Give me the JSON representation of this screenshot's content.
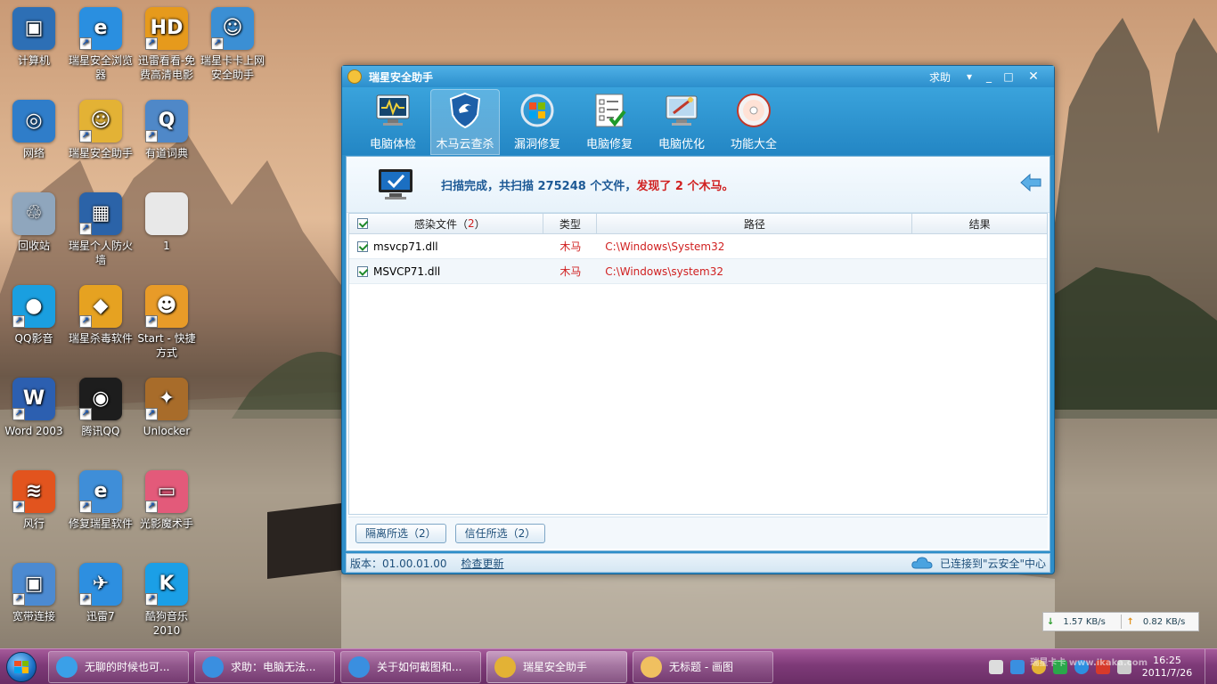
{
  "desktop": {
    "icons": [
      {
        "label": "计算机",
        "color": "#2d6fb5",
        "glyph": "▣"
      },
      {
        "label": "瑞星安全浏览器",
        "color": "#2a8fe0",
        "glyph": "e"
      },
      {
        "label": "迅雷看看-免费高清电影",
        "color": "#e69a1c",
        "glyph": "HD"
      },
      {
        "label": "瑞星卡卡上网安全助手",
        "color": "#3b8fd4",
        "glyph": "☺"
      },
      {
        "label": "网络",
        "color": "#2f7dc9",
        "glyph": "◎"
      },
      {
        "label": "瑞星安全助手",
        "color": "#e3b235",
        "glyph": "☺"
      },
      {
        "label": "有道词典",
        "color": "#4f88c8",
        "glyph": "Q"
      },
      {
        "label": "回收站",
        "color": "#8fa6bd",
        "glyph": "♲"
      },
      {
        "label": "瑞星个人防火墙",
        "color": "#2b63a8",
        "glyph": "▦"
      },
      {
        "label": "1",
        "color": "#e8e8e8",
        "glyph": ""
      },
      {
        "label": "QQ影音",
        "color": "#1a9fe0",
        "glyph": "●"
      },
      {
        "label": "瑞星杀毒软件",
        "color": "#e6a221",
        "glyph": "◆"
      },
      {
        "label": "Start - 快捷方式",
        "color": "#e89b28",
        "glyph": "☻"
      },
      {
        "label": "Word 2003",
        "color": "#2c5fb0",
        "glyph": "W"
      },
      {
        "label": "腾讯QQ",
        "color": "#1d1d1d",
        "glyph": "◉"
      },
      {
        "label": "Unlocker",
        "color": "#a86c2a",
        "glyph": "✦"
      },
      {
        "label": "风行",
        "color": "#e2541e",
        "glyph": "≋"
      },
      {
        "label": "修复瑞星软件",
        "color": "#3f8ed8",
        "glyph": "e"
      },
      {
        "label": "光影魔术手",
        "color": "#e35a7a",
        "glyph": "▭"
      },
      {
        "label": "宽带连接",
        "color": "#4c8ad1",
        "glyph": "▣"
      },
      {
        "label": "迅雷7",
        "color": "#2d8fe0",
        "glyph": "✈"
      },
      {
        "label": "酷狗音乐 2010",
        "color": "#1b9fe6",
        "glyph": "K"
      }
    ]
  },
  "window": {
    "title": "瑞星安全助手",
    "help": "求助",
    "min": "_",
    "max": "□",
    "close": "✕",
    "restore": "▾",
    "tools": [
      {
        "label": "电脑体检",
        "icon": "monitor-check-icon",
        "active": false
      },
      {
        "label": "木马云查杀",
        "icon": "shield-icon",
        "active": true
      },
      {
        "label": "漏洞修复",
        "icon": "windows-update-icon",
        "active": false
      },
      {
        "label": "电脑修复",
        "icon": "checklist-icon",
        "active": false
      },
      {
        "label": "电脑优化",
        "icon": "optimize-icon",
        "active": false
      },
      {
        "label": "功能大全",
        "icon": "disc-icon",
        "active": false
      }
    ],
    "scan": {
      "prefix": "扫描完成，共扫描 ",
      "files": "275248",
      "mid": " 个文件，",
      "found_prefix": "发现了 ",
      "found": "2",
      "found_suffix": " 个木马。"
    },
    "table": {
      "col_file": "感染文件（",
      "col_file_count": "2",
      "col_file_close": "）",
      "col_type": "类型",
      "col_path": "路径",
      "col_result": "结果",
      "rows": [
        {
          "file": "msvcp71.dll",
          "type": "木马",
          "path": "C:\\Windows\\System32",
          "result": ""
        },
        {
          "file": "MSVCP71.dll",
          "type": "木马",
          "path": "C:\\Windows\\system32",
          "result": ""
        }
      ]
    },
    "buttons": {
      "quarantine": "隔离所选（2）",
      "trust": "信任所选（2）"
    },
    "statusbar": {
      "version": "版本：01.00.01.00",
      "check_update": "检查更新",
      "cloud": "已连接到\"云安全\"中心"
    }
  },
  "netspeed": {
    "down": "1.57 KB/s",
    "up": "0.82 KB/s"
  },
  "taskbar": {
    "tasks": [
      {
        "label": "无聊的时候也可...",
        "color": "#3aa0e8",
        "active": false
      },
      {
        "label": "求助：电脑无法...",
        "color": "#3a8fe0",
        "active": false
      },
      {
        "label": "关于如何截图和...",
        "color": "#3a8fe0",
        "active": false
      },
      {
        "label": "瑞星安全助手",
        "color": "#e3b235",
        "active": true
      },
      {
        "label": "无标题 - 画图",
        "color": "#f0c060",
        "active": false
      }
    ],
    "clock_time": "16:25",
    "clock_date": "2011/7/26",
    "watermark": "瑞星卡卡 www.ikaka.com"
  }
}
